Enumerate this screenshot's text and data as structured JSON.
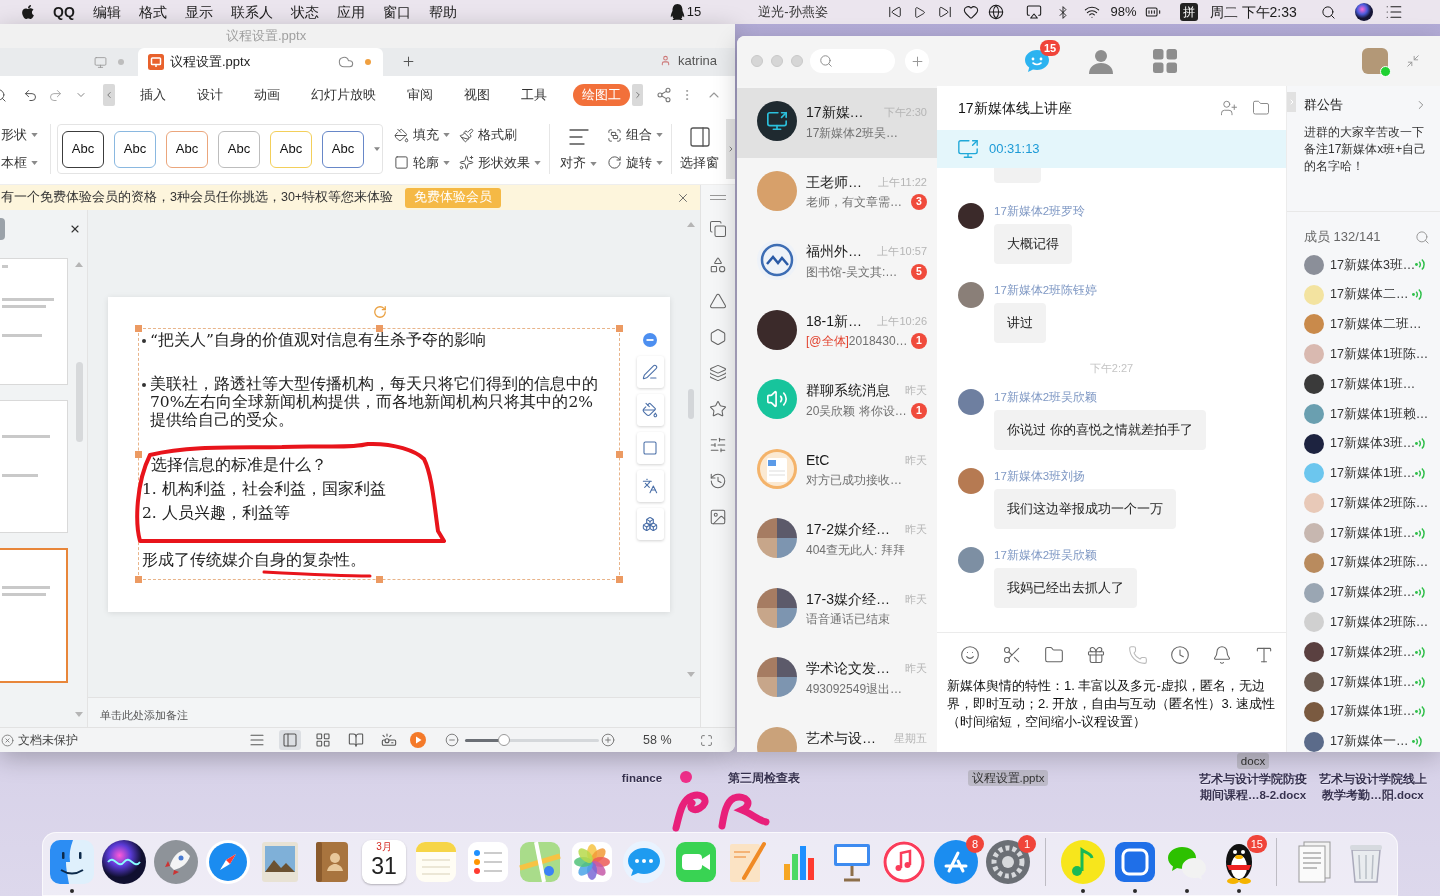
{
  "menu_bar": {
    "app": "QQ",
    "items": [
      "编辑",
      "格式",
      "显示",
      "联系人",
      "状态",
      "应用",
      "窗口",
      "帮助"
    ],
    "qq_count": "15",
    "now_playing": "逆光-孙燕姿",
    "battery": "98%",
    "input_method": "拼",
    "clock": "周二 下午2:33"
  },
  "wps": {
    "title": "议程设置.pptx",
    "tabs": [
      {
        "selected": false,
        "modified": false
      },
      {
        "label": "议程设置.pptx",
        "selected": true,
        "modified": true
      }
    ],
    "user": "katrina",
    "ribbon_tabs": [
      {
        "label": "插入",
        "selected": false
      },
      {
        "label": "设计",
        "selected": false
      },
      {
        "label": "动画",
        "selected": false
      },
      {
        "label": "幻灯片放映",
        "selected": false
      },
      {
        "label": "审阅",
        "selected": false
      },
      {
        "label": "视图",
        "selected": false
      },
      {
        "label": "工具",
        "selected": false
      },
      {
        "label": "绘图工",
        "selected": true
      }
    ],
    "left_tools": [
      {
        "label": "形状",
        "dropdown": true
      },
      {
        "label": "本框",
        "dropdown": true
      }
    ],
    "style_gallery": [
      {
        "label": "Abc",
        "color": "#3c3c3c"
      },
      {
        "label": "Abc",
        "color": "#8ab8e0"
      },
      {
        "label": "Abc",
        "color": "#eba67c"
      },
      {
        "label": "Abc",
        "color": "#bdbdbd"
      },
      {
        "label": "Abc",
        "color": "#f3cf5a"
      },
      {
        "label": "Abc",
        "color": "#6787c8"
      }
    ],
    "shape_tools": [
      {
        "kind": "fill",
        "label": "填充",
        "dropdown": true
      },
      {
        "kind": "brush",
        "label": "格式刷",
        "dropdown": false
      },
      {
        "kind": "outline",
        "label": "轮廓",
        "dropdown": true
      },
      {
        "kind": "effects",
        "label": "形状效果",
        "dropdown": true
      }
    ],
    "arrange_tools": [
      {
        "kind": "align",
        "label": "对齐",
        "dropdown": true
      },
      {
        "kind": "group",
        "label": "组合",
        "dropdown": true
      },
      {
        "kind": "rotate",
        "label": "旋转",
        "dropdown": true
      },
      {
        "kind": "pane",
        "label": "选择窗",
        "dropdown": false
      }
    ],
    "banner": {
      "text": "有一个免费体验会员的资格，3种会员任你挑选，30+特权等您来体验",
      "button": "免费体验会员"
    },
    "thumbnails": [
      {
        "selected": false
      },
      {
        "selected": false
      },
      {
        "selected": true
      }
    ],
    "slide": {
      "bullets": [
        "“把关人”自身的价值观对信息有生杀予夺的影响",
        "美联社，路透社等大型传播机构，每天只将它们得到的信息中的70%左右向全球新闻机构提供，而各地新闻机构只将其中的2%提供给自己的受众。"
      ],
      "question": "选择信息的标准是什么？",
      "list": [
        "1. 机构利益，社会利益，国家利益",
        "2. 人员兴趣，利益等"
      ],
      "conclusion": "形成了传统媒介自身的复杂性。"
    },
    "notes_placeholder": "单击此处添加备注",
    "status": {
      "protection": "文档未保护",
      "view_modes": [
        {
          "kind": "list",
          "selected": false
        },
        {
          "kind": "normal",
          "selected": true
        },
        {
          "kind": "grid",
          "selected": false
        },
        {
          "kind": "reading",
          "selected": false
        },
        {
          "kind": "presenter",
          "selected": false
        }
      ],
      "zoom": {
        "level": 0.29
      },
      "zoom_label": "58 %"
    }
  },
  "qq": {
    "nav": [
      {
        "kind": "chats",
        "selected": true,
        "badge": "15"
      },
      {
        "kind": "contacts",
        "selected": false
      },
      {
        "kind": "apps",
        "selected": false
      }
    ],
    "chats": [
      {
        "kind": "share",
        "title": "17新媒…",
        "time": "下午2:30",
        "preview": "17新媒体2班吴…",
        "selected": true
      },
      {
        "kind": "photo",
        "title": "王老师…",
        "time": "上午11:22",
        "preview": "老师，有文章需…",
        "unread": "3",
        "selected": false
      },
      {
        "kind": "emblem",
        "title": "福州外…",
        "time": "上午10:57",
        "preview": "图书馆-吴文其:…",
        "unread": "5",
        "selected": false
      },
      {
        "kind": "photo",
        "title": "18-1新…",
        "time": "上午10:26",
        "mention": "[@全体]",
        "preview": "2018430…",
        "unread": "1",
        "selected": false
      },
      {
        "kind": "system",
        "title": "群聊系统消息",
        "time": "昨天",
        "preview": "20吴欣颖 将你设…",
        "unread": "1",
        "selected": false
      },
      {
        "kind": "file",
        "title": "EtC",
        "time": "昨天",
        "preview": "对方已成功接收…",
        "selected": false
      },
      {
        "kind": "group",
        "title": "17-2媒介经…",
        "time": "昨天",
        "preview": "404查无此人: 拜拜",
        "selected": false
      },
      {
        "kind": "group",
        "title": "17-3媒介经…",
        "time": "昨天",
        "preview": "语音通话已结束",
        "selected": false
      },
      {
        "kind": "group",
        "title": "学术论文发…",
        "time": "昨天",
        "preview": "493092549退出…",
        "selected": false
      },
      {
        "kind": "photo",
        "title": "艺术与设…",
        "time": "星期五",
        "selected": false
      }
    ],
    "chat": {
      "title": "17新媒体线上讲座",
      "share_time": "00:31:13",
      "messages": [
        {
          "kind": "clipped"
        },
        {
          "kind": "message",
          "sender": "17新媒体2班罗玲",
          "text": "大概记得"
        },
        {
          "kind": "message",
          "sender": "17新媒体2班陈钰婷",
          "text": "讲过"
        },
        {
          "kind": "time",
          "text": "下午2:27"
        },
        {
          "kind": "message",
          "sender": "17新媒体2班吴欣颖",
          "text": "你说过 你的喜悦之情就差拍手了"
        },
        {
          "kind": "message",
          "sender": "17新媒体3班刘扬",
          "text": "我们这边举报成功一个一万"
        },
        {
          "kind": "message",
          "sender": "17新媒体2班吴欣颖",
          "text": "我妈已经出去抓人了"
        }
      ],
      "draft": "新媒体舆情的特性：1. 丰富以及多元-虚拟，匿名，无边界，即时互动；2. 开放，自由与互动（匿名性）3. 速成性（时间缩短，空间缩小-议程设置）"
    },
    "announcement": {
      "title": "群公告",
      "text": "进群的大家辛苦改一下备注17新媒体x班+自己的名字哈！"
    },
    "members_header": "成员 132/141",
    "members": [
      {
        "name": "17新媒体3班…",
        "speaking": true
      },
      {
        "name": "17新媒体二…",
        "speaking": true
      },
      {
        "name": "17新媒体二班…",
        "speaking": false
      },
      {
        "name": "17新媒体1班陈…",
        "speaking": false
      },
      {
        "name": "17新媒体1班…",
        "speaking": false
      },
      {
        "name": "17新媒体1班赖…",
        "speaking": false
      },
      {
        "name": "17新媒体3班…",
        "speaking": true
      },
      {
        "name": "17新媒体1班…",
        "speaking": true
      },
      {
        "name": "17新媒体2班陈…",
        "speaking": false
      },
      {
        "name": "17新媒体1班…",
        "speaking": true
      },
      {
        "name": "17新媒体2班陈…",
        "speaking": false
      },
      {
        "name": "17新媒体2班…",
        "speaking": true
      },
      {
        "name": "17新媒体2班陈…",
        "speaking": false
      },
      {
        "name": "17新媒体2班…",
        "speaking": true
      },
      {
        "name": "17新媒体1班…",
        "speaking": true
      },
      {
        "name": "17新媒体1班…",
        "speaking": true
      },
      {
        "name": "17新媒体一…",
        "speaking": true
      }
    ]
  },
  "desktop": {
    "files": [
      {
        "lines": [
          "finance"
        ],
        "selected": false
      },
      {
        "lines": [
          "第三周检查表"
        ],
        "selected": false
      },
      {
        "lines": [
          "议程设置.pptx"
        ],
        "selected": true
      },
      {
        "lines": [
          "docx"
        ],
        "selected": true
      },
      {
        "lines": [
          "艺术与设计学院防疫",
          "期间课程…8-2.docx"
        ],
        "selected": false
      },
      {
        "lines": [
          "艺术与设计学院线上",
          "教学考勤…阳.docx"
        ],
        "selected": false
      }
    ]
  },
  "dock": [
    {
      "kind": "face",
      "running": true
    },
    {
      "kind": "orb",
      "running": false
    },
    {
      "kind": "rocket",
      "running": false
    },
    {
      "kind": "compass",
      "running": false
    },
    {
      "kind": "picture",
      "running": false
    },
    {
      "kind": "book",
      "running": false
    },
    {
      "kind": "calendar",
      "month": "3月",
      "day": "31",
      "running": false
    },
    {
      "kind": "notepad",
      "running": false
    },
    {
      "kind": "checklist",
      "running": false
    },
    {
      "kind": "map",
      "running": false
    },
    {
      "kind": "flower",
      "running": false
    },
    {
      "kind": "bubble",
      "running": false
    },
    {
      "kind": "camera",
      "running": false
    },
    {
      "kind": "pages",
      "running": false
    },
    {
      "kind": "chart",
      "running": false
    },
    {
      "kind": "podium",
      "running": false
    },
    {
      "kind": "note",
      "running": false
    },
    {
      "kind": "store",
      "badge": "8",
      "running": false
    },
    {
      "kind": "gear",
      "badge": "1",
      "running": false
    },
    {
      "kind": "separator"
    },
    {
      "kind": "tune",
      "running": true
    },
    {
      "kind": "doc",
      "running": true
    },
    {
      "kind": "chat",
      "running": true
    },
    {
      "kind": "penguin",
      "badge": "15",
      "running": true
    },
    {
      "kind": "separator"
    },
    {
      "kind": "stack",
      "running": false
    },
    {
      "kind": "trash",
      "running": false
    }
  ]
}
